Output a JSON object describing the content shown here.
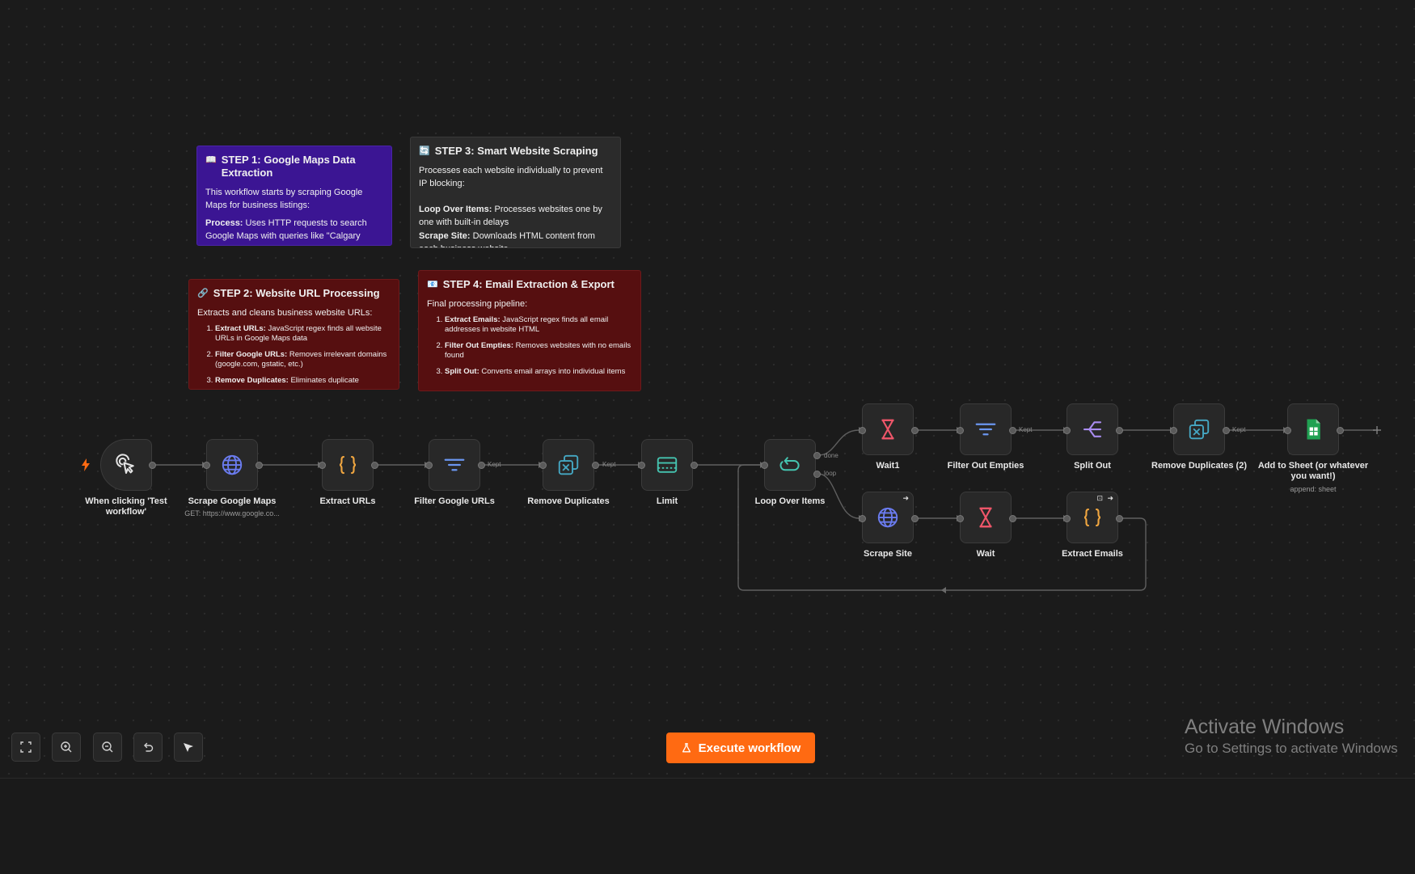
{
  "notes": {
    "step1": {
      "icon": "📖",
      "title": "STEP 1: Google Maps Data Extraction",
      "p1": "This workflow starts by scraping Google Maps for business listings:",
      "p2_bold": "Process:",
      "p2": " Uses HTTP requests to search Google Maps with queries like \"Calgary"
    },
    "step3": {
      "icon": "🔄",
      "title": "STEP 3: Smart Website Scraping",
      "p1": "Processes each website individually to prevent IP blocking:",
      "i1_bold": "Loop Over Items:",
      "i1": " Processes websites one by one with built-in delays",
      "i2_bold": "Scrape Site:",
      "i2": " Downloads HTML content from each business website"
    },
    "step2": {
      "icon": "🔗",
      "title": "STEP 2: Website URL Processing",
      "p1": "Extracts and cleans business website URLs:",
      "li1_bold": "Extract URLs:",
      "li1": " JavaScript regex finds all website URLs in Google Maps data",
      "li2_bold": "Filter Google URLs:",
      "li2": " Removes irrelevant domains (google.com, gstatic, etc.)",
      "li3_bold": "Remove Duplicates:",
      "li3": " Eliminates duplicate"
    },
    "step4": {
      "icon": "📧",
      "title": "STEP 4: Email Extraction & Export",
      "p1": "Final processing pipeline:",
      "li1_bold": "Extract Emails:",
      "li1": " JavaScript regex finds all email addresses in website HTML",
      "li2_bold": "Filter Out Empties:",
      "li2": " Removes websites with no emails found",
      "li3_bold": "Split Out:",
      "li3": " Converts email arrays into individual items"
    }
  },
  "nodes": {
    "trigger": {
      "label": "When clicking 'Test workflow'",
      "icon": "cursor-click-icon"
    },
    "scrape_maps": {
      "label": "Scrape Google Maps",
      "sub": "GET: https://www.google.co...",
      "icon": "globe-icon"
    },
    "extract_urls": {
      "label": "Extract URLs",
      "icon": "code-braces-icon"
    },
    "filter_google": {
      "label": "Filter Google URLs",
      "icon": "filter-icon"
    },
    "remove_dupes": {
      "label": "Remove Duplicates",
      "icon": "remove-duplicates-icon"
    },
    "limit": {
      "label": "Limit",
      "icon": "limit-icon"
    },
    "loop": {
      "label": "Loop Over Items",
      "icon": "loop-icon"
    },
    "wait1": {
      "label": "Wait1",
      "icon": "hourglass-icon"
    },
    "filter_empties": {
      "label": "Filter Out Empties",
      "icon": "filter-icon"
    },
    "split_out": {
      "label": "Split Out",
      "icon": "split-icon"
    },
    "remove_dupes2": {
      "label": "Remove Duplicates (2)",
      "icon": "remove-duplicates-icon"
    },
    "add_sheet": {
      "label": "Add to Sheet (or whatever you want!)",
      "sub": "append: sheet",
      "icon": "google-sheets-icon"
    },
    "scrape_site": {
      "label": "Scrape Site",
      "icon": "globe-icon"
    },
    "wait": {
      "label": "Wait",
      "icon": "hourglass-icon"
    },
    "extract_emails": {
      "label": "Extract Emails",
      "icon": "code-braces-icon"
    }
  },
  "edge_labels": {
    "kept": "Kept",
    "done": "done",
    "loop": "loop"
  },
  "toolbar": {
    "execute_label": "Execute workflow",
    "execute_icon": "flask-icon"
  },
  "controls": [
    "fit-view-icon",
    "zoom-in-icon",
    "zoom-out-icon",
    "undo-icon",
    "tidy-up-icon"
  ],
  "windows": {
    "line1": "Activate Windows",
    "line2": "Go to Settings to activate Windows"
  },
  "colors": {
    "accent": "#ff6a12",
    "canvas": "#1b1b1b",
    "note_purple": "#3b1593",
    "note_red": "#560f10",
    "note_gray": "#2b2b2b",
    "icon_blue": "#6b7cf0",
    "icon_orange": "#f0a640",
    "icon_red": "#f0566a",
    "icon_purple": "#a98cf0",
    "icon_teal": "#45c4b0",
    "icon_green": "#20a152"
  }
}
